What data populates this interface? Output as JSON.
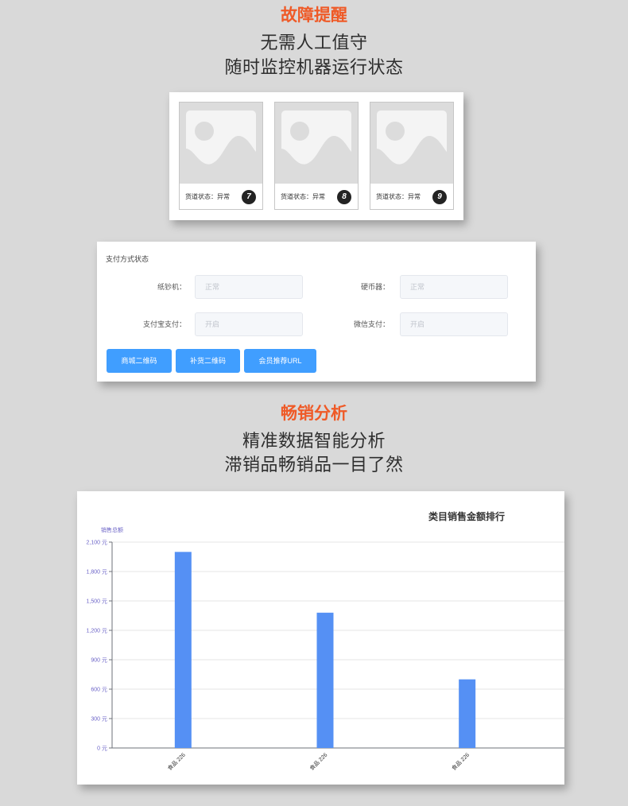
{
  "colors": {
    "accent": "#ef5a27",
    "primary_button": "#409eff",
    "bar": "#5590f4",
    "axis_text": "#6b63c7",
    "badge": "#232323",
    "background": "#d9d9d9"
  },
  "fault_alert": {
    "title": "故障提醒",
    "lines": [
      "无需人工值守",
      "随时监控机器运行状态"
    ],
    "slots": [
      {
        "image": "image-placeholder",
        "status": "货道状态：异常",
        "number": "7"
      },
      {
        "image": "image-placeholder",
        "status": "货道状态：异常",
        "number": "8"
      },
      {
        "image": "image-placeholder",
        "status": "货道状态：异常",
        "number": "9"
      }
    ]
  },
  "payment_status": {
    "title": "支付方式状态",
    "fields": [
      {
        "label": "纸钞机：",
        "value": "正常"
      },
      {
        "label": "硬币器：",
        "value": "正常"
      },
      {
        "label": "支付宝支付：",
        "value": "开启"
      },
      {
        "label": "微信支付：",
        "value": "开启"
      }
    ],
    "buttons": [
      "商城二维码",
      "补货二维码",
      "会员推荐URL"
    ]
  },
  "sales_analysis": {
    "title": "畅销分析",
    "lines": [
      "精准数据智能分析",
      "滞销品畅销品一目了然"
    ]
  },
  "chart_data": {
    "type": "bar",
    "title": "类目销售金额排行",
    "ylabel": "销售总额",
    "xlabel": "",
    "categories": [
      "食品 226",
      "食品 226",
      "食品 226"
    ],
    "values": [
      2000,
      1380,
      700
    ],
    "ylim": [
      0,
      2100
    ],
    "yticks": [
      0,
      300,
      600,
      900,
      1200,
      1500,
      1800,
      2100
    ],
    "ytick_labels": [
      "0 元",
      "300 元",
      "600 元",
      "900 元",
      "1,200 元",
      "1,500 元",
      "1,800 元",
      "2,100 元"
    ],
    "grid": true
  }
}
